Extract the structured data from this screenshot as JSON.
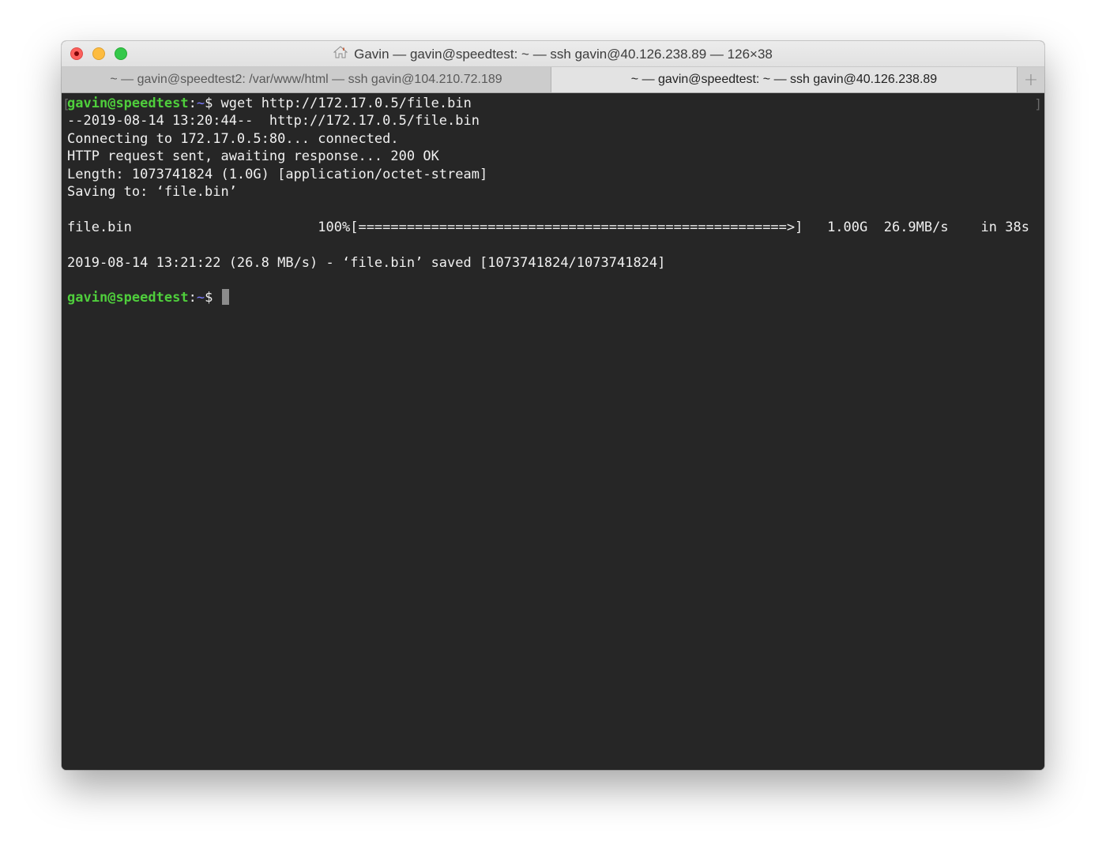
{
  "window": {
    "title": "Gavin — gavin@speedtest: ~ — ssh gavin@40.126.238.89 — 126×38"
  },
  "tabs": [
    {
      "label": "~ — gavin@speedtest2: /var/www/html — ssh gavin@104.210.72.189",
      "active": false
    },
    {
      "label": "~ — gavin@speedtest: ~ — ssh gavin@40.126.238.89",
      "active": true
    }
  ],
  "new_tab_icon": "plus-icon",
  "prompt": {
    "user": "gavin",
    "at": "@",
    "host": "speedtest",
    "sep": ":",
    "path": "~",
    "symbol": "$"
  },
  "terminal": {
    "command": " wget http://172.17.0.5/file.bin",
    "output": [
      "--2019-08-14 13:20:44--  http://172.17.0.5/file.bin",
      "Connecting to 172.17.0.5:80... connected.",
      "HTTP request sent, awaiting response... 200 OK",
      "Length: 1073741824 (1.0G) [application/octet-stream]",
      "Saving to: ‘file.bin’",
      "",
      "file.bin                       100%[=====================================================>]   1.00G  26.9MB/s    in 38s",
      "",
      "2019-08-14 13:21:22 (26.8 MB/s) - ‘file.bin’ saved [1073741824/1073741824]",
      ""
    ],
    "second_prompt_suffix": " "
  },
  "colors": {
    "prompt_user": "#4fce3c",
    "prompt_path": "#7b7bff",
    "background": "#262626",
    "text": "#f0f0f0"
  }
}
